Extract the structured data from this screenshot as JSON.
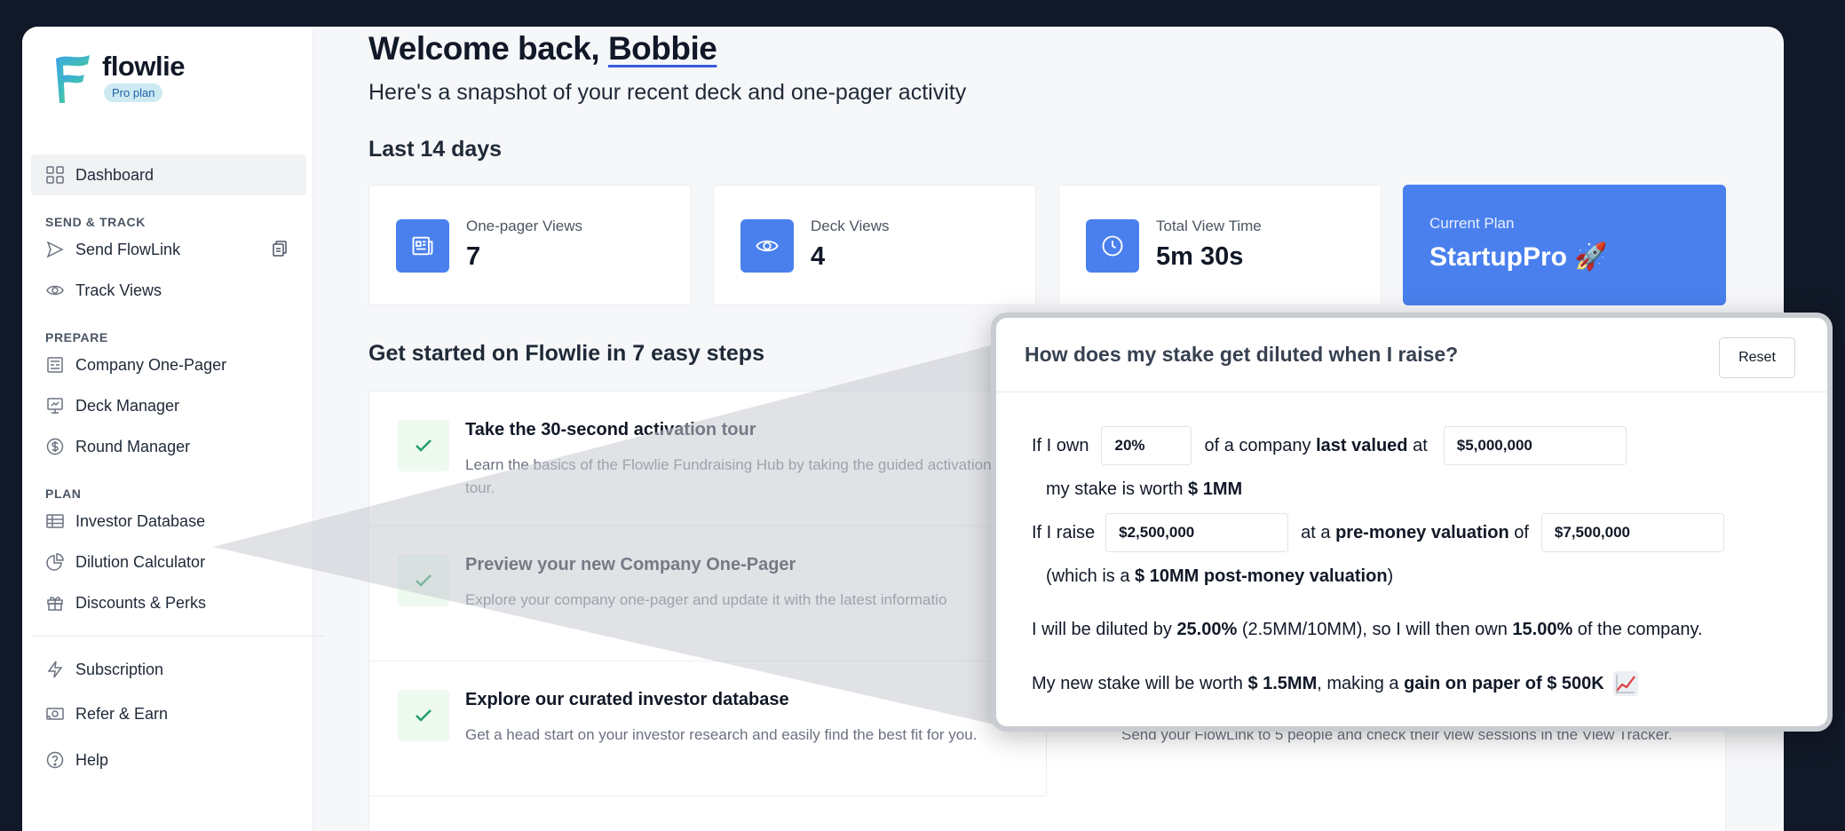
{
  "brand": {
    "name": "flowlie",
    "plan_badge": "Pro plan"
  },
  "sidebar": {
    "dashboard": "Dashboard",
    "sections": [
      {
        "title": "SEND & TRACK",
        "items": [
          {
            "label": "Send FlowLink",
            "icon": "send-icon"
          },
          {
            "label": "Track Views",
            "icon": "eye-icon"
          }
        ]
      },
      {
        "title": "PREPARE",
        "items": [
          {
            "label": "Company One-Pager",
            "icon": "document-icon"
          },
          {
            "label": "Deck Manager",
            "icon": "presentation-icon"
          },
          {
            "label": "Round Manager",
            "icon": "dollar-icon"
          }
        ]
      },
      {
        "title": "PLAN",
        "items": [
          {
            "label": "Investor Database",
            "icon": "table-icon"
          },
          {
            "label": "Dilution Calculator",
            "icon": "pie-icon"
          },
          {
            "label": "Discounts & Perks",
            "icon": "gift-icon"
          }
        ]
      }
    ],
    "footer": [
      {
        "label": "Subscription",
        "icon": "bolt-icon"
      },
      {
        "label": "Refer & Earn",
        "icon": "cash-icon"
      },
      {
        "label": "Help",
        "icon": "help-icon"
      }
    ]
  },
  "header": {
    "welcome_prefix": "Welcome back,",
    "user_name": "Bobbie",
    "subtitle": "Here's a snapshot of your recent deck and one-pager activity",
    "period": "Last 14 days"
  },
  "stats": [
    {
      "label": "One-pager Views",
      "value": "7",
      "icon": "newspaper-icon"
    },
    {
      "label": "Deck Views",
      "value": "4",
      "icon": "eye-icon"
    },
    {
      "label": "Total View Time",
      "value": "5m 30s",
      "icon": "clock-icon"
    }
  ],
  "plan": {
    "label": "Current Plan",
    "value": "StartupPro 🚀"
  },
  "steps": {
    "title": "Get started on Flowlie in 7 easy steps",
    "items": [
      {
        "title": "Take the 30-second activation tour",
        "desc": "Learn the basics of the Flowlie Fundraising Hub by taking the guided activation tour."
      },
      {
        "title": "Preview your new Company One-Pager",
        "desc": "Explore your company one-pager and update it with the latest informatio"
      },
      {
        "title": "Explore our curated investor database",
        "desc": "Get a head start on your investor research and easily find the best fit for you."
      }
    ],
    "right_desc": "Send your FlowLink to 5 people and check their view sessions in the View Tracker."
  },
  "calculator": {
    "title": "How does my stake get diluted when I raise?",
    "reset": "Reset",
    "row1": {
      "t1": "If I own",
      "own": "20%",
      "t2": "of a company",
      "b1": "last valued",
      "t3": "at",
      "valuation": "$5,000,000"
    },
    "row2": {
      "t1": "my stake is worth",
      "b1": "$ 1MM"
    },
    "row3": {
      "t1": "If I raise",
      "raise": "$2,500,000",
      "t2": "at a",
      "b1": "pre-money valuation",
      "t3": "of",
      "premoney": "$7,500,000"
    },
    "row4": {
      "t1": "(which is a",
      "b1": "$ 10MM post-money valuation",
      "t2": ")"
    },
    "row5": {
      "t1": "I will be diluted by",
      "b1": "25.00%",
      "t2": "(2.5MM/10MM), so I will then own",
      "b2": "15.00%",
      "t3": "of the company."
    },
    "row6": {
      "t1": "My new stake will be worth",
      "b1": "$ 1.5MM",
      "t2": ", making a",
      "b2": "gain on paper of $ 500K"
    }
  }
}
